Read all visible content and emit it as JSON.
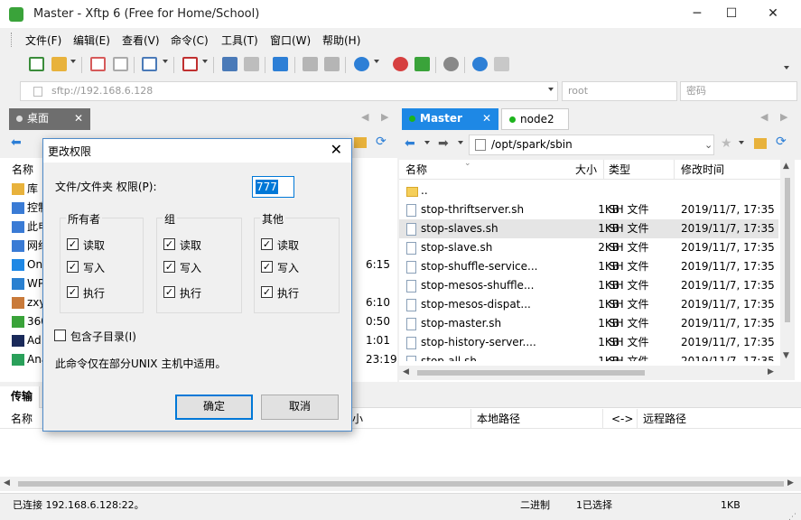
{
  "window": {
    "title": "Master - Xftp 6 (Free for Home/School)",
    "minimize": "─",
    "maximize": "☐",
    "close": "✕"
  },
  "menu": [
    "文件(F)",
    "编辑(E)",
    "查看(V)",
    "命令(C)",
    "工具(T)",
    "窗口(W)",
    "帮助(H)"
  ],
  "address_bar": {
    "host_placeholder": "sftp://192.168.6.128",
    "user_placeholder": "root",
    "password_placeholder": "密码"
  },
  "left_pane": {
    "tab": "桌面",
    "column_name": "名称",
    "items": [
      {
        "name": "库",
        "color": "#e8b23c",
        "time": ""
      },
      {
        "name": "控制",
        "color": "#3a7bd5",
        "time": ""
      },
      {
        "name": "此电",
        "color": "#3a7bd5",
        "time": ""
      },
      {
        "name": "网络",
        "color": "#3a7bd5",
        "time": ""
      },
      {
        "name": "On",
        "color": "#1e88e5",
        "time": "6:15"
      },
      {
        "name": "WP",
        "color": "#2a80d0",
        "time": ""
      },
      {
        "name": "zxy",
        "color": "#c97a3a",
        "time": "6:10"
      },
      {
        "name": "360",
        "color": "#3aa33a",
        "time": "0:50"
      },
      {
        "name": "Ad",
        "color": "#1a2a5a",
        "time": "1:01"
      },
      {
        "name": "Ana",
        "color": "#2aa05a",
        "time": "23:19"
      }
    ]
  },
  "right_pane": {
    "tabs": [
      {
        "label": "Master",
        "active": true
      },
      {
        "label": "node2",
        "active": false
      }
    ],
    "path": "/opt/spark/sbin",
    "columns": {
      "name": "名称",
      "size": "大小",
      "type": "类型",
      "modified": "修改时间"
    },
    "files": [
      {
        "name": "..",
        "size": "",
        "type": "",
        "modified": "",
        "folder": true
      },
      {
        "name": "stop-thriftserver.sh",
        "size": "1KB",
        "type": "SH 文件",
        "modified": "2019/11/7, 17:35"
      },
      {
        "name": "stop-slaves.sh",
        "size": "1KB",
        "type": "SH 文件",
        "modified": "2019/11/7, 17:35",
        "selected": true
      },
      {
        "name": "stop-slave.sh",
        "size": "2KB",
        "type": "SH 文件",
        "modified": "2019/11/7, 17:35"
      },
      {
        "name": "stop-shuffle-service...",
        "size": "1KB",
        "type": "SH 文件",
        "modified": "2019/11/7, 17:35"
      },
      {
        "name": "stop-mesos-shuffle...",
        "size": "1KB",
        "type": "SH 文件",
        "modified": "2019/11/7, 17:35"
      },
      {
        "name": "stop-mesos-dispat...",
        "size": "1KB",
        "type": "SH 文件",
        "modified": "2019/11/7, 17:35"
      },
      {
        "name": "stop-master.sh",
        "size": "1KB",
        "type": "SH 文件",
        "modified": "2019/11/7, 17:35"
      },
      {
        "name": "stop-history-server....",
        "size": "1KB",
        "type": "SH 文件",
        "modified": "2019/11/7, 17:35"
      },
      {
        "name": "stop-all.sh",
        "size": "1KB",
        "type": "SH 文件",
        "modified": "2019/11/7, 17:35"
      }
    ]
  },
  "transfer": {
    "tab": "传输",
    "columns": {
      "name": "名称",
      "size": "小",
      "local_path": "本地路径",
      "direction": "<->",
      "remote_path": "远程路径"
    }
  },
  "dialog": {
    "title": "更改权限",
    "permission_label": "文件/文件夹 权限(P):",
    "permission_value": "777",
    "groups": [
      {
        "title": "所有者",
        "read": "读取",
        "write": "写入",
        "exec": "执行"
      },
      {
        "title": "组",
        "read": "读取",
        "write": "写入",
        "exec": "执行"
      },
      {
        "title": "其他",
        "read": "读取",
        "write": "写入",
        "exec": "执行"
      }
    ],
    "check_mark": "✓",
    "include_subdirs": "包含子目录(I)",
    "note": "此命令仅在部分UNIX 主机中适用。",
    "ok": "确定",
    "cancel": "取消"
  },
  "status": {
    "connection": "已连接 192.168.6.128:22。",
    "mode": "二进制",
    "selection": "1已选择",
    "size": "1KB"
  },
  "colors": {
    "accent": "#0078d7",
    "active_tab": "#1e88e5",
    "green_dot": "#1db41d"
  }
}
